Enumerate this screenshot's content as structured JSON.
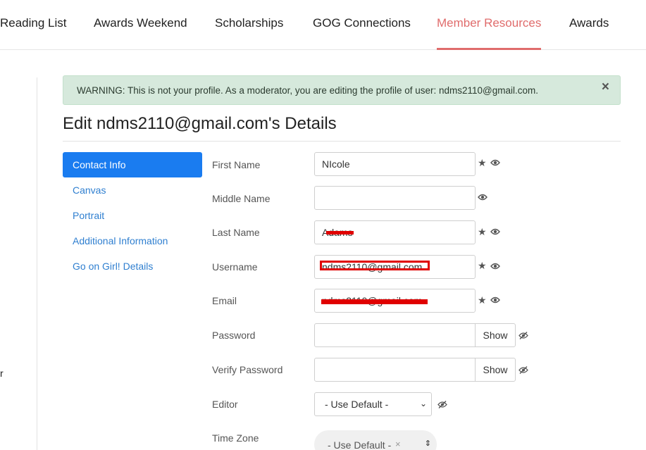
{
  "nav": {
    "items": [
      {
        "label": "Reading List"
      },
      {
        "label": "Awards Weekend"
      },
      {
        "label": "Scholarships"
      },
      {
        "label": "GOG Connections"
      },
      {
        "label": "Member Resources",
        "active": true
      },
      {
        "label": "Awards"
      }
    ],
    "active_color": "#e06c6c"
  },
  "sidebar_fragment": "r",
  "alert": {
    "text": "WARNING: This is not your profile. As a moderator, you are editing the profile of user: ndms2110@gmail.com.",
    "close_label": "×"
  },
  "title": "Edit ndms2110@gmail.com's Details",
  "tabs": [
    {
      "label": "Contact Info",
      "active": true
    },
    {
      "label": "Canvas"
    },
    {
      "label": "Portrait"
    },
    {
      "label": "Additional Information"
    },
    {
      "label": "Go on Girl! Details"
    }
  ],
  "form": {
    "first_name": {
      "label": "First Name",
      "value": "NIcole",
      "icons": [
        "star-icon",
        "eye-icon"
      ]
    },
    "middle_name": {
      "label": "Middle Name",
      "value": "",
      "icons": [
        "eye-icon"
      ]
    },
    "last_name": {
      "label": "Last Name",
      "value": "Adams",
      "icons": [
        "star-icon",
        "eye-icon"
      ]
    },
    "username": {
      "label": "Username",
      "value": "ndms2110@gmail.com",
      "icons": [
        "star-icon",
        "eye-icon"
      ]
    },
    "email": {
      "label": "Email",
      "value": "ndms2110@gmail.com",
      "icons": [
        "star-icon",
        "eye-icon"
      ]
    },
    "password": {
      "label": "Password",
      "value": "",
      "show_label": "Show",
      "icons": [
        "eye-slash-icon"
      ]
    },
    "verify_password": {
      "label": "Verify Password",
      "value": "",
      "show_label": "Show",
      "icons": [
        "eye-slash-icon"
      ]
    },
    "editor": {
      "label": "Editor",
      "selected": "- Use Default -",
      "icons": [
        "eye-slash-icon"
      ]
    },
    "time_zone": {
      "label": "Time Zone",
      "selected": "- Use Default -",
      "clear": "×"
    }
  },
  "colors": {
    "tab_active": "#1a7cf0",
    "link": "#2f7fd0",
    "alert_bg": "#d6e9dc",
    "redaction": "#e00000"
  }
}
